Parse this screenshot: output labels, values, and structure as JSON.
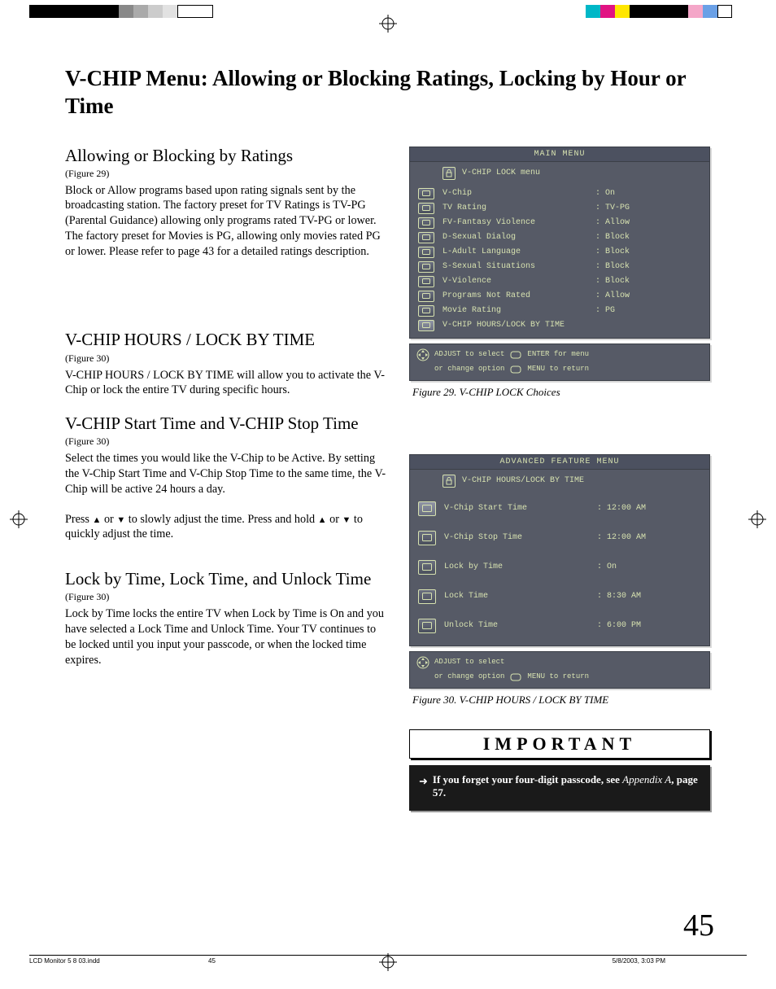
{
  "page_title": "V-CHIP Menu:  Allowing or Blocking Ratings, Locking by Hour or Time",
  "page_number": "45",
  "footer": {
    "file": "LCD Monitor 5 8 03.indd",
    "pg": "45",
    "date": "5/8/2003, 3:03 PM"
  },
  "sec1": {
    "heading": "Allowing or Blocking  by Ratings",
    "figref": "(Figure 29)",
    "body": "Block or Allow programs based upon rating signals sent by the broadcasting station.  The factory preset for TV Ratings is TV-PG (Parental Guidance) allowing only programs rated TV-PG or lower.  The factory preset for Movies is PG, allowing only movies rated PG or lower.  Please refer to page 43 for a detailed ratings description."
  },
  "sec2": {
    "heading": "V-CHIP HOURS / LOCK BY TIME",
    "figref": "(Figure 30)",
    "body": "V-CHIP HOURS / LOCK BY TIME will allow you to activate the V-Chip or lock the entire TV during specific hours."
  },
  "sec3": {
    "heading": "V-CHIP Start Time and V-CHIP Stop Time",
    "figref": "(Figure 30)",
    "body1": "Select the times you would like the V-Chip to be Active.  By setting the V-Chip Start Time and V-Chip Stop Time to the same time, the V-Chip will be active 24 hours a day.",
    "body2_a": "Press ",
    "body2_b": " or  ",
    "body2_c": " to slowly adjust the time.  Press and hold ",
    "body2_d": " or ",
    "body2_e": " to quickly adjust the time."
  },
  "sec4": {
    "heading": "Lock by Time, Lock Time, and Unlock Time",
    "figref": "(Figure 30)",
    "body": "Lock by Time locks the entire TV when Lock by Time is On and you have selected a Lock Time and Unlock Time.  Your TV continues to be locked until you input your passcode, or when the locked time expires."
  },
  "osd1": {
    "title": "MAIN MENU",
    "sub": "V-CHIP LOCK menu",
    "rows": [
      {
        "label": "V-Chip",
        "val": "On"
      },
      {
        "label": "TV Rating",
        "val": "TV-PG"
      },
      {
        "label": "FV-Fantasy Violence",
        "val": "Allow"
      },
      {
        "label": "D-Sexual Dialog",
        "val": "Block"
      },
      {
        "label": "L-Adult Language",
        "val": "Block"
      },
      {
        "label": "S-Sexual Situations",
        "val": "Block"
      },
      {
        "label": "V-Violence",
        "val": "Block"
      },
      {
        "label": "Programs Not Rated",
        "val": "Allow"
      },
      {
        "label": "Movie Rating",
        "val": "PG"
      },
      {
        "label": "V-CHIP HOURS/LOCK BY TIME",
        "val": ""
      }
    ],
    "help1a": "ADJUST to select",
    "help1b": "ENTER for menu",
    "help2a": "or  change option",
    "help2b": "MENU to return",
    "caption": "Figure 29.  V-CHIP LOCK Choices"
  },
  "osd2": {
    "title": "ADVANCED FEATURE MENU",
    "sub": "V-CHIP HOURS/LOCK BY TIME",
    "rows": [
      {
        "label": "V-Chip Start Time",
        "val": "12:00 AM"
      },
      {
        "label": "V-Chip Stop Time",
        "val": "12:00 AM"
      },
      {
        "label": "Lock by Time",
        "val": "On"
      },
      {
        "label": "Lock Time",
        "val": "8:30 AM"
      },
      {
        "label": "Unlock Time",
        "val": "6:00 PM"
      }
    ],
    "help1a": "ADJUST to select",
    "help2a": "or  change option",
    "help2b": "MENU to return",
    "caption": "Figure 30.  V-CHIP HOURS / LOCK BY TIME"
  },
  "important": {
    "title": "IMPORTANT",
    "body_a": "If you forget your four-digit passcode, see ",
    "body_b": "Appendix A",
    "body_c": ", page 57."
  }
}
